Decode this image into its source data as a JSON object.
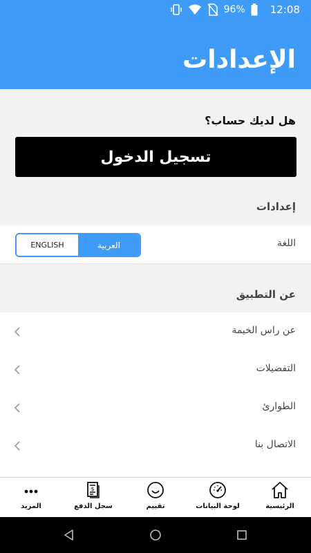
{
  "status_bar": {
    "battery_percent": "96%",
    "time": "12:08",
    "icons": [
      "vibrate-icon",
      "wifi-icon",
      "no-sim-icon",
      "battery-icon"
    ]
  },
  "header": {
    "title": "الإعدادات"
  },
  "account": {
    "question": "هل لديك حساب؟",
    "login_label": "تسجيل الدخول"
  },
  "settings": {
    "section_title": "إعدادات",
    "language_label": "اللغة",
    "language_options": {
      "english": "ENGLISH",
      "arabic": "العربية"
    },
    "selected_language": "العربية"
  },
  "about": {
    "section_title": "عن التطبيق",
    "items": [
      {
        "label": "عن راس الخيمة"
      },
      {
        "label": "التفضيلات"
      },
      {
        "label": "الطوارئ"
      },
      {
        "label": "الاتصال بنا"
      }
    ]
  },
  "bottom_nav": {
    "items": [
      {
        "label": "الرئيسية",
        "icon": "home-icon"
      },
      {
        "label": "لوحة البيانات",
        "icon": "dashboard-gauge-icon"
      },
      {
        "label": "تقييم",
        "icon": "smiley-icon"
      },
      {
        "label": "سجل الدفع",
        "icon": "payment-receipt-icon"
      },
      {
        "label": "المزيد",
        "icon": "more-dots-icon"
      }
    ]
  },
  "colors": {
    "accent": "#3f9bf8",
    "button": "#000000",
    "background": "#f2f2f2"
  }
}
